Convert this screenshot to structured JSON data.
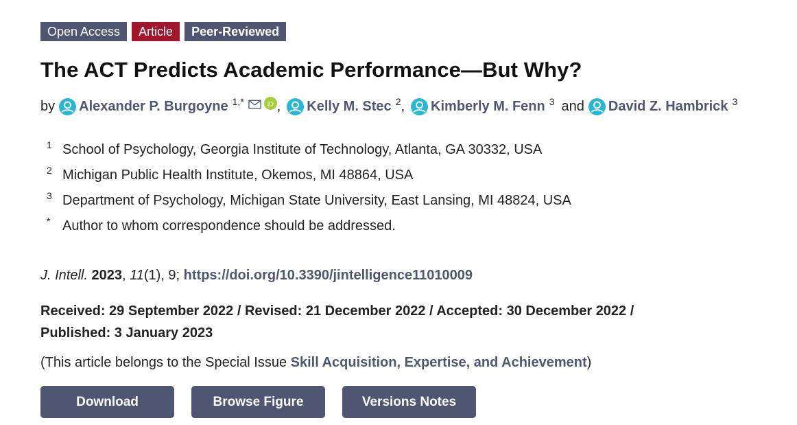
{
  "badges": {
    "open_access": "Open Access",
    "article": "Article",
    "peer_reviewed": "Peer-Reviewed"
  },
  "title": "The ACT Predicts Academic Performance—But Why?",
  "byline": {
    "by": "by",
    "authors": [
      {
        "name": "Alexander P. Burgoyne",
        "sup": "1,*"
      },
      {
        "name": "Kelly M. Stec",
        "sup": "2"
      },
      {
        "name": "Kimberly M. Fenn",
        "sup": "3"
      },
      {
        "name": "David Z. Hambrick",
        "sup": "3"
      }
    ],
    "comma": ",",
    "and": "and"
  },
  "affiliations": [
    {
      "marker": "1",
      "text": "School of Psychology, Georgia Institute of Technology, Atlanta, GA 30332, USA"
    },
    {
      "marker": "2",
      "text": "Michigan Public Health Institute, Okemos, MI 48864, USA"
    },
    {
      "marker": "3",
      "text": "Department of Psychology, Michigan State University, East Lansing, MI 48824, USA"
    },
    {
      "marker": "*",
      "text": "Author to whom correspondence should be addressed."
    }
  ],
  "citation": {
    "journal": "J. Intell.",
    "year": "2023",
    "volume": "11",
    "issue_and_page": "(1), 9; ",
    "doi": "https://doi.org/10.3390/jintelligence11010009"
  },
  "dates": "Received: 29 September 2022 / Revised: 21 December 2022 / Accepted: 30 December 2022 / Published: 3 January 2023",
  "special_issue": {
    "prefix": "(This article belongs to the Special Issue ",
    "link": "Skill Acquisition, Expertise, and Achievement",
    "suffix": ")"
  },
  "buttons": {
    "download": "Download",
    "browse_figure": "Browse Figure",
    "versions_notes": "Versions Notes"
  },
  "colors": {
    "accent": "#4f5671",
    "article_badge": "#a3172d",
    "person_icon": "#29b8d3",
    "orcid": "#a6ce39"
  }
}
